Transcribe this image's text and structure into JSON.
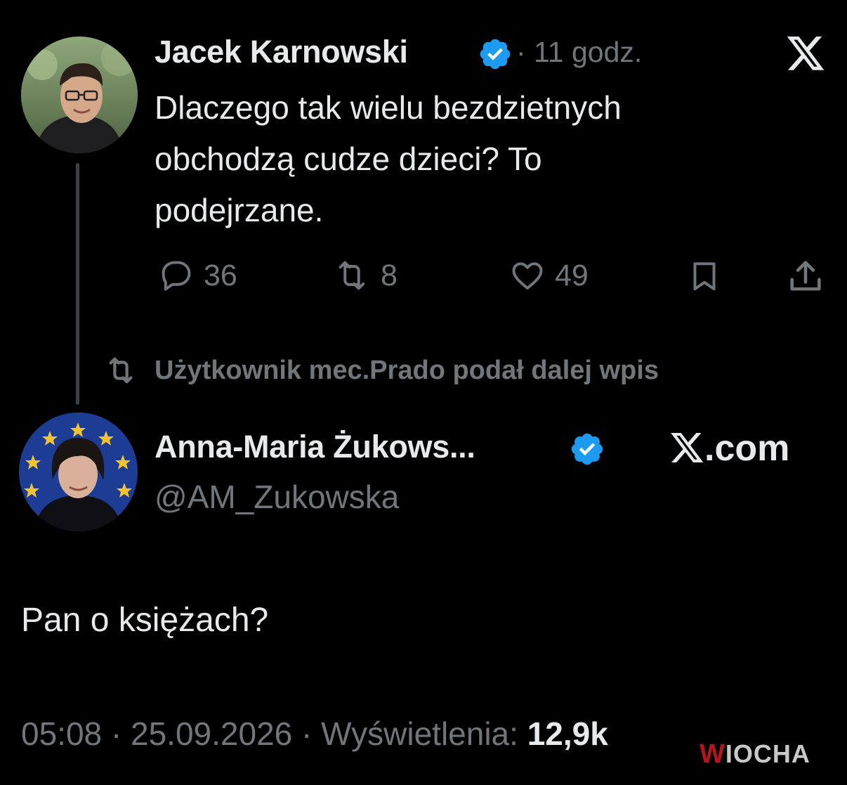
{
  "colors": {
    "background": "#000000",
    "text_primary": "#e7e9ea",
    "text_secondary": "#71767b",
    "verified_badge": "#1d9bf0",
    "thread_line": "#3e4144",
    "watermark_accent": "#b3161c"
  },
  "quoted_tweet": {
    "author_name": "Jacek Karnowski",
    "verified": true,
    "separator": "·",
    "time": "11 godz.",
    "platform_icon": "x-logo-icon",
    "text_lines": [
      "Dlaczego tak wielu bezdzietnych",
      "obchodzą cudze dzieci? To",
      "podejrzane."
    ],
    "actions": {
      "reply": {
        "icon": "reply-icon",
        "count": "36"
      },
      "retweet": {
        "icon": "retweet-icon",
        "count": "8"
      },
      "like": {
        "icon": "heart-icon",
        "count": "49"
      },
      "bookmark": {
        "icon": "bookmark-icon"
      },
      "share": {
        "icon": "share-icon"
      }
    }
  },
  "repost_context": {
    "icon": "retweet-icon",
    "text": "Użytkownik mec.Prado podał dalej wpis"
  },
  "main_tweet": {
    "author_name": "Anna-Maria Żukows...",
    "verified": true,
    "handle": "@AM_Zukowska",
    "platform_label": ".com",
    "platform_icon": "x-logo-icon",
    "text": "Pan o księżach?",
    "time": "05:08",
    "separator": "·",
    "date": "25.09.2026",
    "views_label": "Wyświetlenia:",
    "views_count": "12,9k"
  },
  "watermark": {
    "text": "WIOCHA"
  }
}
